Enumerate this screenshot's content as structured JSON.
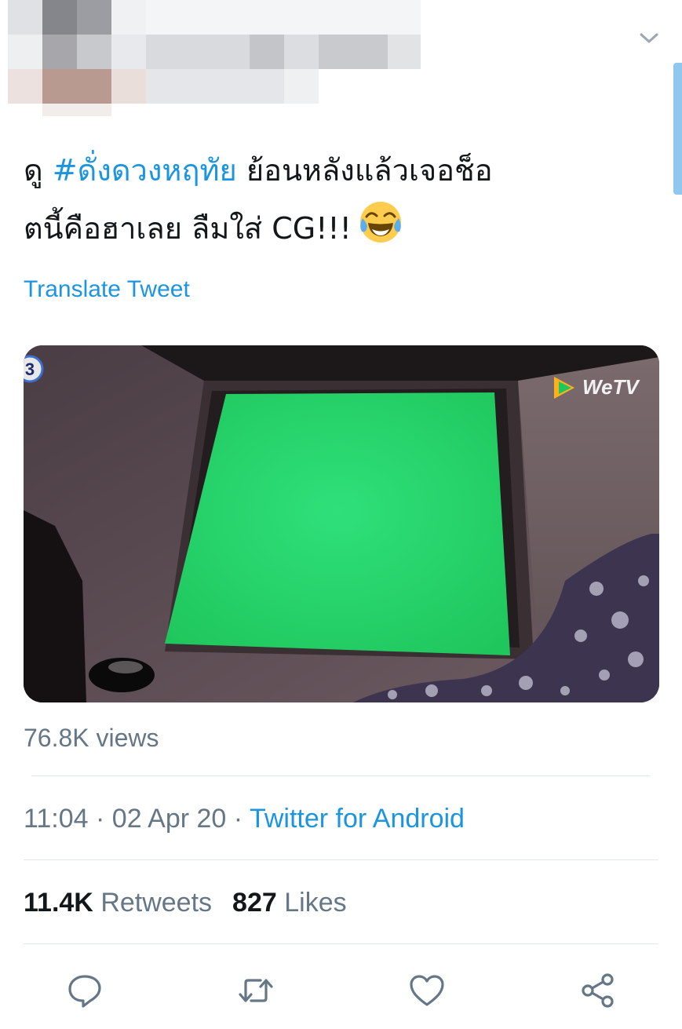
{
  "tweet": {
    "text_prefix": "ดู ",
    "hashtag": "#ดั่งดวงหฤทัย",
    "text_line1_rest": " ย้อนหลังแล้วเจอช็อ",
    "text_line2": "ตนี้คือฮาเลย ลืมใส่ CG!!!",
    "emoji": "face-with-tears-of-joy-icon",
    "translate_label": "Translate Tweet"
  },
  "media": {
    "channel_badge": "3",
    "watermark": "WeTV"
  },
  "views": "76.8K views",
  "meta": {
    "time": "11:04",
    "date": "02 Apr 20",
    "separator": " · ",
    "source": "Twitter for Android"
  },
  "stats": {
    "retweets_count": "11.4K",
    "retweets_label": "Retweets",
    "likes_count": "827",
    "likes_label": "Likes"
  },
  "colors": {
    "link": "#1b95e0",
    "secondary_text": "#657786",
    "primary_text": "#14171a",
    "divider": "#e1e8ed",
    "action_icon": "#657786"
  },
  "icons": [
    "chevron-down-icon",
    "reply-icon",
    "retweet-icon",
    "like-icon",
    "share-icon"
  ]
}
